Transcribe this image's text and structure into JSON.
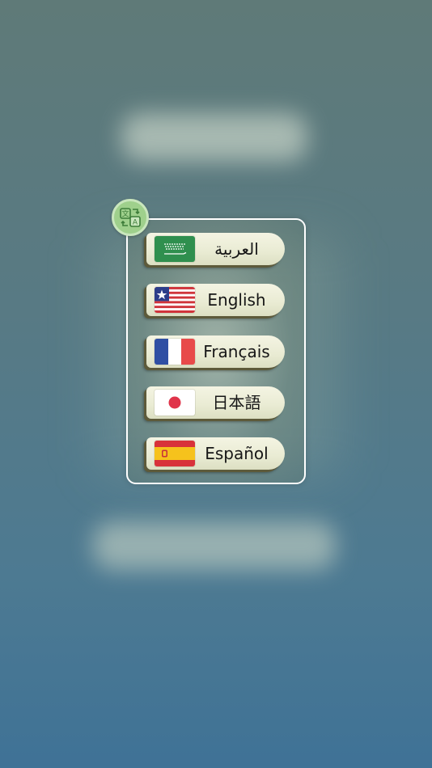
{
  "languages": [
    {
      "label": "العربية",
      "flag_icon": "saudi-arabia-flag-icon"
    },
    {
      "label": "English",
      "flag_icon": "liberia-flag-icon"
    },
    {
      "label": "Français",
      "flag_icon": "france-flag-icon"
    },
    {
      "label": "日本語",
      "flag_icon": "japan-flag-icon"
    },
    {
      "label": "Español",
      "flag_icon": "spain-flag-icon"
    }
  ],
  "badge_icon": "translate-icon",
  "colors": {
    "badge_green": "#9fd08c",
    "panel_border": "#ffffff",
    "button_face": "#eceed6",
    "button_shadow": "#5d5a3a"
  }
}
